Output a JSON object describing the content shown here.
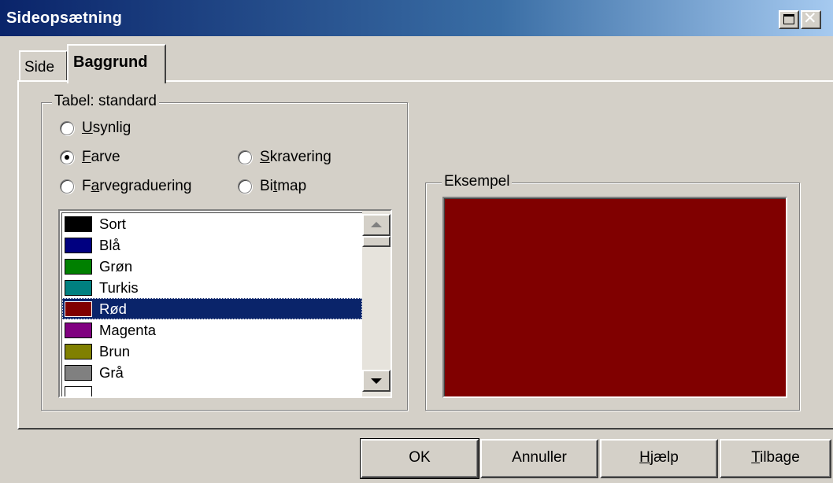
{
  "window": {
    "title": "Sideopsætning"
  },
  "tabs": [
    {
      "label": "Side",
      "active": false
    },
    {
      "label": "Baggrund",
      "active": true
    }
  ],
  "fill_group": {
    "label": "Tabel: standard",
    "options": [
      {
        "pre": "",
        "key": "U",
        "post": "synlig",
        "checked": false
      },
      {
        "pre": "",
        "key": "F",
        "post": "arve",
        "checked": true
      },
      {
        "pre": "",
        "key": "S",
        "post": "kravering",
        "checked": false
      },
      {
        "pre": "F",
        "key": "a",
        "post": "rvegraduering",
        "checked": false
      },
      {
        "pre": "Bi",
        "key": "t",
        "post": "map",
        "checked": false
      }
    ]
  },
  "colors": {
    "selected_index": 4,
    "items": [
      {
        "name": "Sort",
        "color": "#000000"
      },
      {
        "name": "Blå",
        "color": "#000080"
      },
      {
        "name": "Grøn",
        "color": "#008000"
      },
      {
        "name": "Turkis",
        "color": "#008080"
      },
      {
        "name": "Rød",
        "color": "#800000"
      },
      {
        "name": "Magenta",
        "color": "#800080"
      },
      {
        "name": "Brun",
        "color": "#808000"
      },
      {
        "name": "Grå",
        "color": "#808080"
      },
      {
        "name": "",
        "color": "#ffffff"
      }
    ]
  },
  "preview": {
    "label": "Eksempel",
    "color": "#800000"
  },
  "buttons": {
    "ok": {
      "pre": "OK",
      "key": "",
      "post": ""
    },
    "cancel": {
      "pre": "Annuller",
      "key": "",
      "post": ""
    },
    "help": {
      "pre": "",
      "key": "H",
      "post": "jælp"
    },
    "back": {
      "pre": "",
      "key": "T",
      "post": "ilbage"
    }
  }
}
